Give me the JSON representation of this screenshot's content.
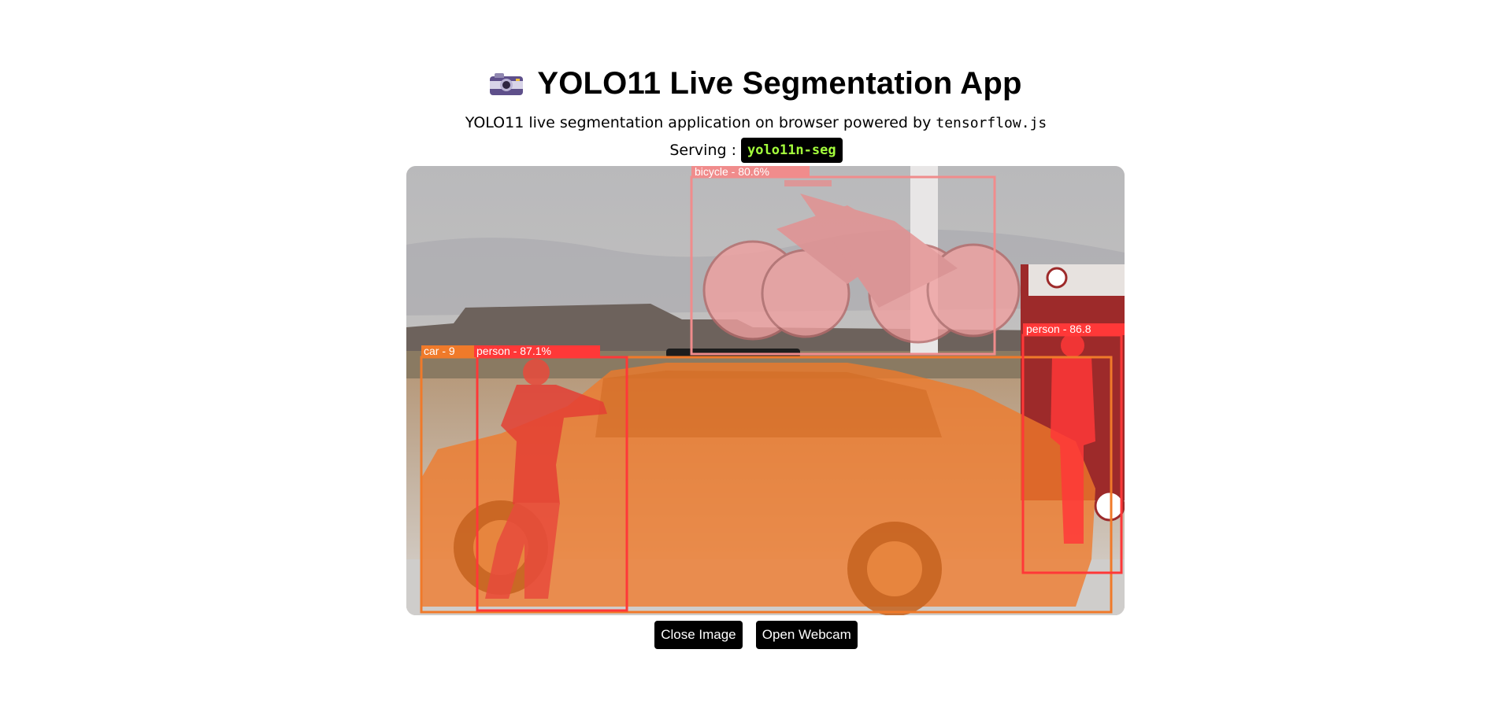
{
  "app": {
    "title": "YOLO11 Live Segmentation App",
    "title_icon": "camera-icon",
    "subtitle_text": "YOLO11 live segmentation application on browser powered by",
    "subtitle_code": "tensorflow.js",
    "serving_label": "Serving :",
    "model_name": "yolo11n-seg"
  },
  "detections": [
    {
      "label": "bicycle - 80.6%",
      "class": "bicycle",
      "color": "#f08c8c"
    },
    {
      "label": "car - 9",
      "class": "car",
      "color": "#f07a2a"
    },
    {
      "label": "person - 87.1%",
      "class": "person",
      "color": "#ff3838"
    },
    {
      "label": "person - 86.8",
      "class": "person",
      "color": "#ff3838"
    }
  ],
  "controls": {
    "close_image_label": "Close Image",
    "open_webcam_label": "Open Webcam"
  },
  "colors": {
    "badge_bg": "#000000",
    "badge_text": "#a4ff3c",
    "button_bg": "#000000",
    "button_text": "#ffffff"
  }
}
